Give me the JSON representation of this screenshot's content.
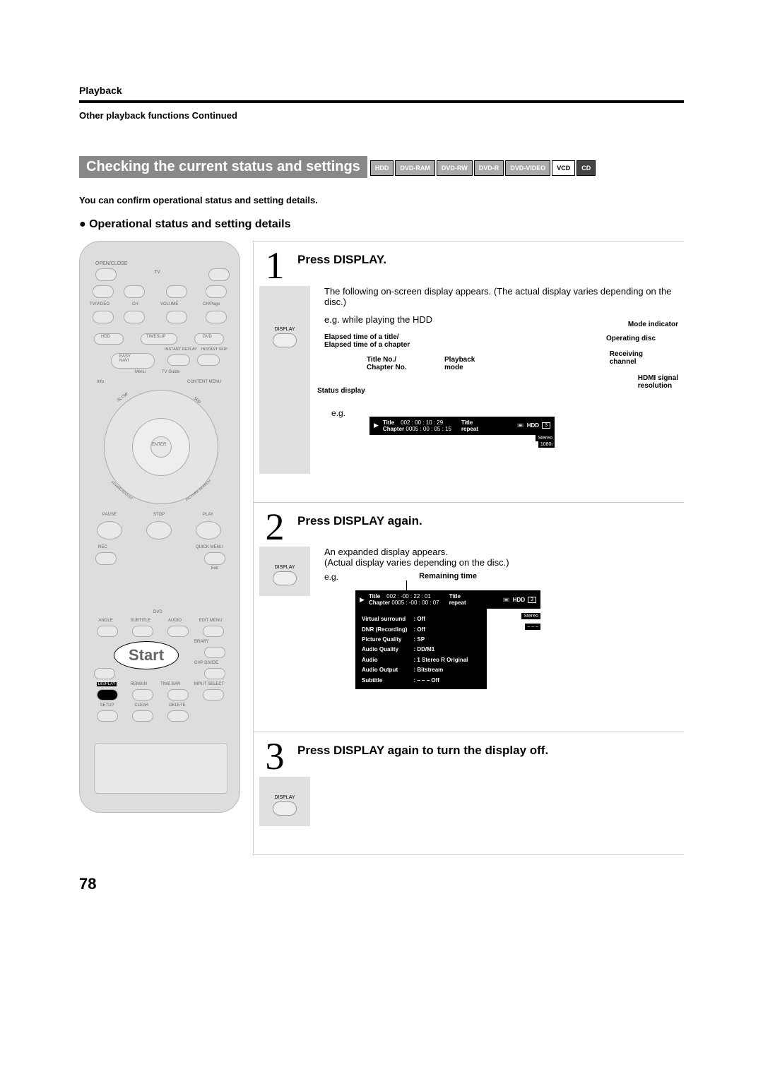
{
  "header": {
    "section": "Playback",
    "subsection": "Other playback functions Continued"
  },
  "title": "Checking the current status and settings",
  "discs": [
    "HDD",
    "DVD-RAM",
    "DVD-RW",
    "DVD-R",
    "DVD-VIDEO",
    "VCD",
    "CD"
  ],
  "intro": "You can confirm operational status and setting details.",
  "heading": "Operational status and setting details",
  "remote": {
    "start_label": "Start",
    "display_label": "DISPLAY",
    "labels": {
      "open_close": "OPEN/CLOSE",
      "tv": "TV",
      "tv_video": "TV/VIDEO",
      "ch": "CH",
      "volume": "VOLUME",
      "ch_page": "CH/Page",
      "hdd": "HDD",
      "timeslip": "TIMESLIP",
      "dvd": "DVD",
      "easy_navi": "EASY NAVI",
      "instant_replay": "INSTANT REPLAY",
      "instant_skip": "INSTANT SKIP",
      "menu": "Menu",
      "tv_guide": "TV Guide",
      "info": "Info",
      "content_menu": "CONTENT MENU",
      "enter": "ENTER",
      "slow": "SLOW",
      "skip": "SKIP",
      "frame_adjust": "FRAME/ADJUST",
      "picture_search": "PICTURE SEARCH",
      "pause": "PAUSE",
      "stop": "STOP",
      "play": "PLAY",
      "rec": "REC",
      "quick_menu": "QUICK MENU",
      "exit": "Exit",
      "dvd2": "DVD",
      "angle": "ANGLE",
      "subtitle": "SUBTITLE",
      "audio": "AUDIO",
      "edit_menu": "EDIT MENU",
      "library": "LIBRARY",
      "chp_divide": "CHP DIVIDE",
      "remain": "REMAIN",
      "display": "DISPLAY",
      "time_bar": "TIME BAR",
      "input_select": "INPUT SELECT",
      "setup": "SETUP",
      "clear": "CLEAR",
      "delete": "DELETE"
    }
  },
  "steps": [
    {
      "num": "1",
      "title": "Press DISPLAY.",
      "body1": "The following on-screen display appears. (The actual display varies depending on the disc.)",
      "body2": "e.g. while playing the HDD",
      "annotations": {
        "status_display": "Status display",
        "title_chapter": "Title No./\nChapter No.",
        "elapsed": "Elapsed time of a title/\nElapsed time of a chapter",
        "playback_mode": "Playback mode",
        "mode_indicator": "Mode indicator",
        "operating_disc": "Operating disc",
        "receiving_channel": "Receiving channel",
        "hdmi": "HDMI signal resolution",
        "eg": "e.g."
      },
      "osd": {
        "title_label": "Title",
        "title_val": "002 :",
        "title_time": "00 : 10 : 29",
        "chapter_label": "Chapter",
        "chapter_val": "0005 :",
        "chapter_time": "00 : 05 : 15",
        "mode1": "Title",
        "mode2": "repeat",
        "disc": "HDD",
        "ch": "3",
        "audio": "Stereo",
        "res": "1080i"
      }
    },
    {
      "num": "2",
      "title": "Press DISPLAY again.",
      "body1": "An expanded display appears.",
      "body2": "(Actual display varies depending on the disc.)",
      "eg": "e.g.",
      "remaining": "Remaining time",
      "osd": {
        "title_label": "Title",
        "title_val": "002 :",
        "title_time": "-00 : 22 : 01",
        "chapter_label": "Chapter",
        "chapter_val": "0005 :",
        "chapter_time": "-00 : 00 : 07",
        "mode1": "Title",
        "mode2": "repeat",
        "disc": "HDD",
        "ch": "3",
        "audio": "Stereo",
        "blank": "– – –"
      },
      "settings": [
        [
          "Virtual surround",
          ": Off"
        ],
        [
          "DNR (Recording)",
          ": Off"
        ],
        [
          "Picture Quality",
          ": SP"
        ],
        [
          "Audio Quality",
          ": DD/M1"
        ],
        [
          "Audio",
          ": 1 Stereo R Original"
        ],
        [
          "Audio Output",
          ": Bitstream"
        ],
        [
          "Subtitle",
          ": – – – Off"
        ]
      ]
    },
    {
      "num": "3",
      "title": "Press DISPLAY again to turn the display off."
    }
  ],
  "page_number": "78"
}
